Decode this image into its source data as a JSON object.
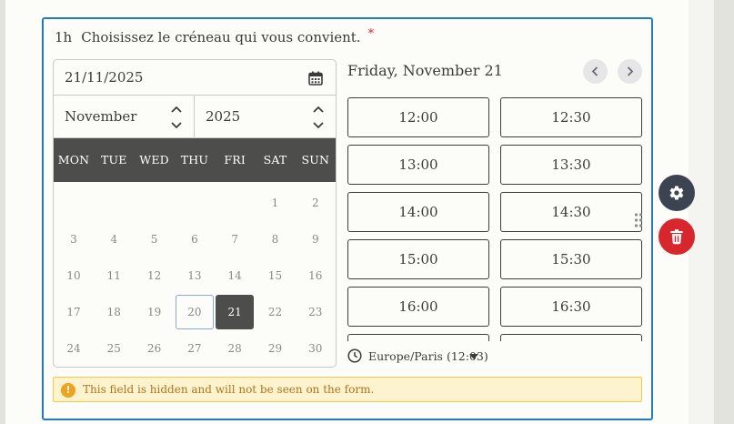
{
  "field": {
    "duration": "1h",
    "label": "Choisissez le créneau qui vous convient.",
    "required_mark": "*"
  },
  "calendar": {
    "date_value": "21/11/2025",
    "month_select": "November",
    "year_select": "2025",
    "weekdays": [
      "MON",
      "TUE",
      "WED",
      "THU",
      "FRI",
      "SAT",
      "SUN"
    ],
    "weeks": [
      [
        "",
        "",
        "",
        "",
        "",
        "1",
        "2"
      ],
      [
        "3",
        "4",
        "5",
        "6",
        "7",
        "8",
        "9"
      ],
      [
        "10",
        "11",
        "12",
        "13",
        "14",
        "15",
        "16"
      ],
      [
        "17",
        "18",
        "19",
        "20",
        "21",
        "22",
        "23"
      ],
      [
        "24",
        "25",
        "26",
        "27",
        "28",
        "29",
        "30"
      ]
    ],
    "today": "20",
    "selected": "21"
  },
  "slots_panel": {
    "day_heading": "Friday, November 21",
    "slots": [
      "12:00",
      "12:30",
      "13:00",
      "13:30",
      "14:00",
      "14:30",
      "15:00",
      "15:30",
      "16:00",
      "16:30",
      "",
      ""
    ],
    "timezone": "Europe/Paris (12:03)"
  },
  "notice": {
    "text": "This field is hidden and will not be seen on the form."
  },
  "actions": {
    "settings_icon": "gear-icon",
    "delete_icon": "trash-icon"
  },
  "colors": {
    "accent": "#1f7ac7",
    "header_dark": "#4d4d4b",
    "danger": "#d9262c",
    "settings_bg": "#3c4452",
    "warning": "#f0a21c"
  }
}
